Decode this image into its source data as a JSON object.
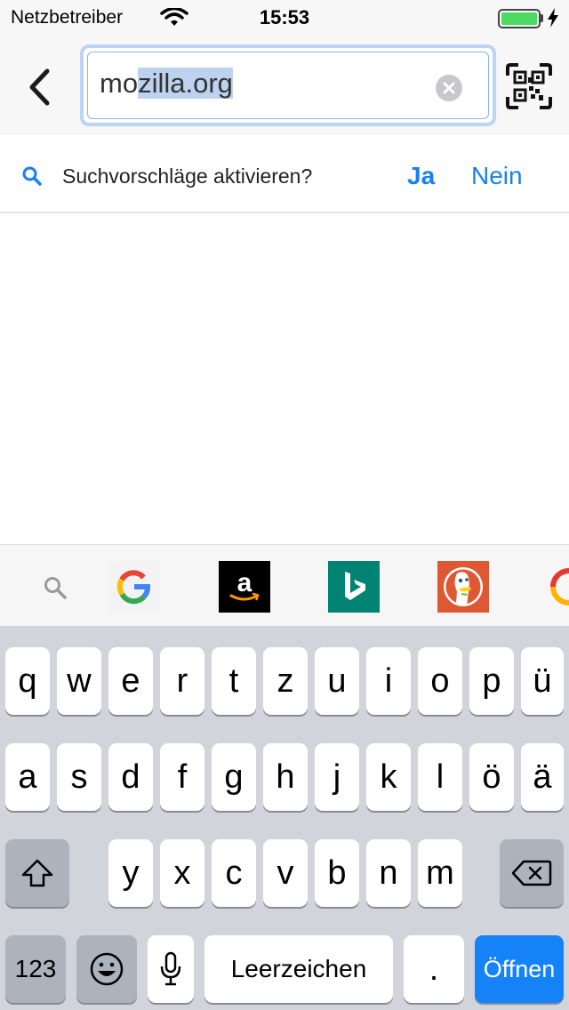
{
  "status_bar": {
    "carrier": "Netzbetreiber",
    "time": "15:53",
    "battery_level": 1.0,
    "battery_color": "#4cd964"
  },
  "url_bar": {
    "url_prefix": "mo",
    "url_selected": "zilla.org",
    "back_icon": "chevron-left-icon",
    "clear_icon": "clear-circle-icon",
    "qr_icon": "qr-code-scan-icon"
  },
  "suggestion_prompt": {
    "text": "Suchvorschläge aktivieren?",
    "yes_label": "Ja",
    "no_label": "Nein",
    "accent": "#1780f4"
  },
  "search_engines": [
    {
      "name": "google",
      "icon": "google-logo-icon"
    },
    {
      "name": "amazon",
      "icon": "amazon-logo-icon"
    },
    {
      "name": "bing",
      "icon": "bing-logo-icon"
    },
    {
      "name": "duckduckgo",
      "icon": "duckduckgo-logo-icon"
    },
    {
      "name": "partial",
      "icon": "partial-engine-icon"
    }
  ],
  "keyboard": {
    "row1": [
      "q",
      "w",
      "e",
      "r",
      "t",
      "z",
      "u",
      "i",
      "o",
      "p",
      "ü"
    ],
    "row2": [
      "a",
      "s",
      "d",
      "f",
      "g",
      "h",
      "j",
      "k",
      "l",
      "ö",
      "ä"
    ],
    "row3": [
      "y",
      "x",
      "c",
      "v",
      "b",
      "n",
      "m"
    ],
    "numbers_label": "123",
    "space_label": "Leerzeichen",
    "period_label": ".",
    "go_label": "Öffnen",
    "go_color": "#1682f8"
  }
}
